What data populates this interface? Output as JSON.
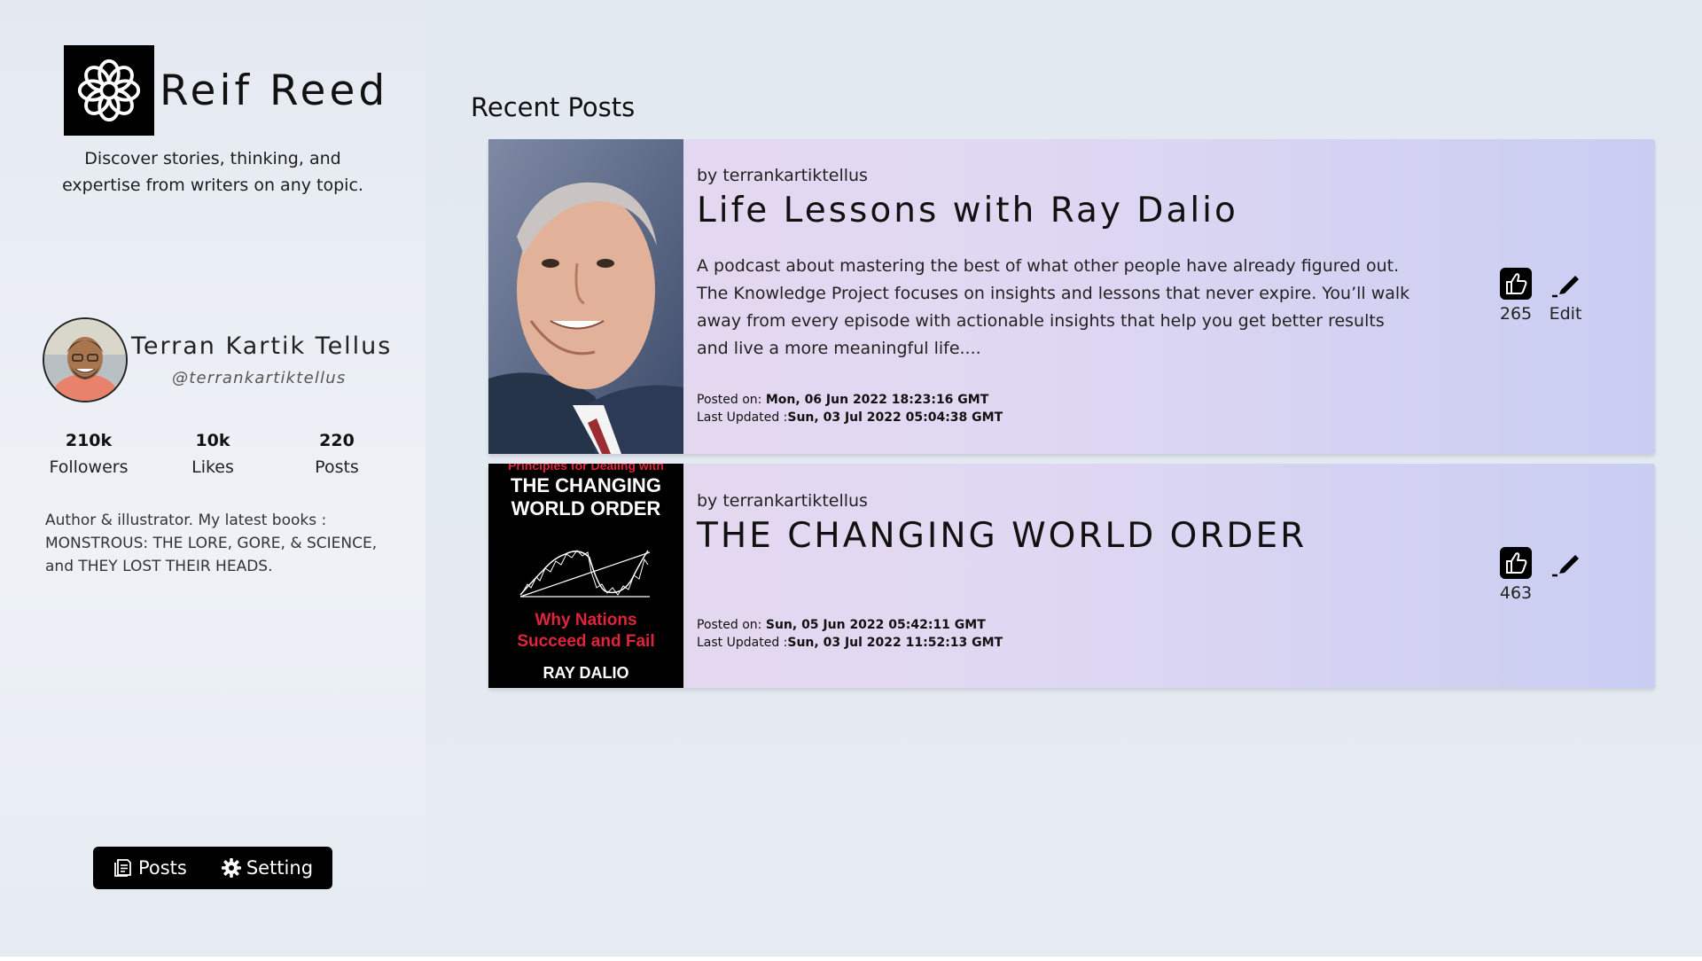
{
  "brand": {
    "name": "Reif Reed"
  },
  "tagline": "Discover stories, thinking, and expertise from writers on any topic.",
  "profile": {
    "name": "Terran Kartik Tellus",
    "handle": "@terrankartiktellus",
    "stats": [
      {
        "value": "210k",
        "label": "Followers"
      },
      {
        "value": "10k",
        "label": "Likes"
      },
      {
        "value": "220",
        "label": "Posts"
      }
    ],
    "bio": "Author & illustrator. My latest books : MONSTROUS: THE LORE, GORE, & SCIENCE, and THEY LOST THEIR HEADS."
  },
  "nav": {
    "posts_label": "Posts",
    "setting_label": "Setting"
  },
  "main": {
    "section_title": "Recent Posts",
    "posts": [
      {
        "author": "by terrankartiktellus",
        "title": "Life Lessons with Ray Dalio",
        "excerpt": "A podcast about mastering the best of what other people have already figured out. The Knowledge Project focuses on insights and lessons that never expire. You’ll walk away from every episode with actionable insights that help you get better results and live a more meaningful life....",
        "posted_label": "Posted on: ",
        "posted_value": "Mon, 06 Jun 2022 18:23:16 GMT",
        "updated_label": "Last Updated :",
        "updated_value": "Sun, 03 Jul 2022 05:04:38 GMT",
        "likes": "265",
        "edit_label": "Edit"
      },
      {
        "author": "by terrankartiktellus",
        "title": "THE CHANGING WORLD ORDER",
        "posted_label": "Posted on: ",
        "posted_value": "Sun, 05 Jun 2022 05:42:11 GMT",
        "updated_label": "Last Updated :",
        "updated_value": "Sun, 03 Jul 2022 11:52:13 GMT",
        "likes": "463",
        "cover": {
          "top_text": "Principles for Dealing with",
          "title_line1": "THE CHANGING",
          "title_line2": "WORLD ORDER",
          "subtitle_line1": "Why Nations",
          "subtitle_line2": "Succeed and Fail",
          "author": "RAY DALIO"
        }
      }
    ]
  },
  "colors": {
    "accent": "#000000",
    "card_gradient_start": "#e7d8ef",
    "card_gradient_end": "#c9cdf2",
    "cover_red": "#e0243b"
  }
}
